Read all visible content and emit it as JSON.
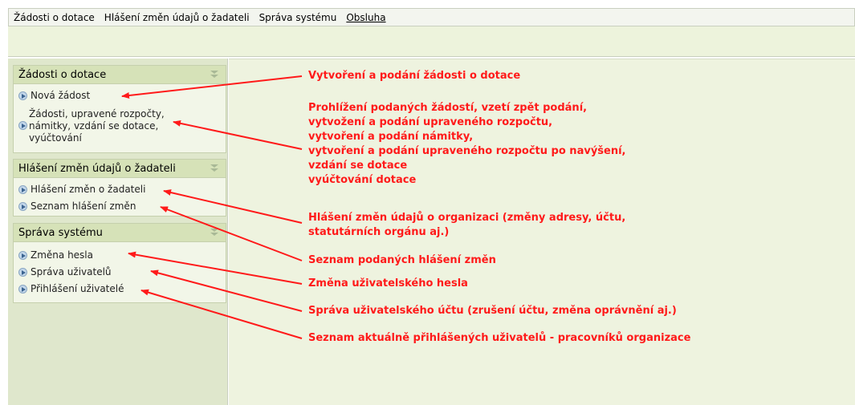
{
  "menubar": {
    "items": [
      "Žádosti o dotace",
      "Hlášení změn údajů o žadateli",
      "Správa systému",
      "Obsluha"
    ]
  },
  "sidebar": {
    "sections": [
      {
        "title": "Žádosti o dotace",
        "items": [
          "Nová žádost"
        ],
        "multi_item": [
          "Žádosti, upravené rozpočty,",
          "námitky, vzdání se dotace,",
          "vyúčtování"
        ]
      },
      {
        "title": "Hlášení změn údajů o žadateli",
        "items": [
          "Hlášení změn o žadateli",
          "Seznam hlášení změn"
        ]
      },
      {
        "title": "Správa systému",
        "items": [
          "Změna hesla",
          "Správa uživatelů",
          "Přihlášení uživatelé"
        ]
      }
    ]
  },
  "annotations": {
    "a1": "Vytvoření a podání žádosti o dotace",
    "a2": [
      "Prohlížení podaných žádostí, vzetí zpět podání,",
      "vytvožení a podání upraveného rozpočtu,",
      "vytvoření a podání námitky,",
      "vytvoření a podání upraveného rozpočtu po navýšení,",
      "vzdání se dotace",
      "vyúčtování dotace"
    ],
    "a3": [
      "Hlášení změn údajů o organizaci (změny adresy, účtu,",
      "statutárních orgánu aj.)"
    ],
    "a4": "Seznam podaných hlášení změn",
    "a5": "Změna uživatelského hesla",
    "a6": "Správa uživatelského účtu (zrušení účtu, změna oprávnění aj.)",
    "a7": "Seznam aktuálně přihlášených uživatelů - pracovníků organizace"
  },
  "colors": {
    "annotation": "#ff1a1a",
    "panel_header": "#d6e2b8",
    "sidebar_bg": "#dfe7cc",
    "content_bg": "#eef3df"
  }
}
